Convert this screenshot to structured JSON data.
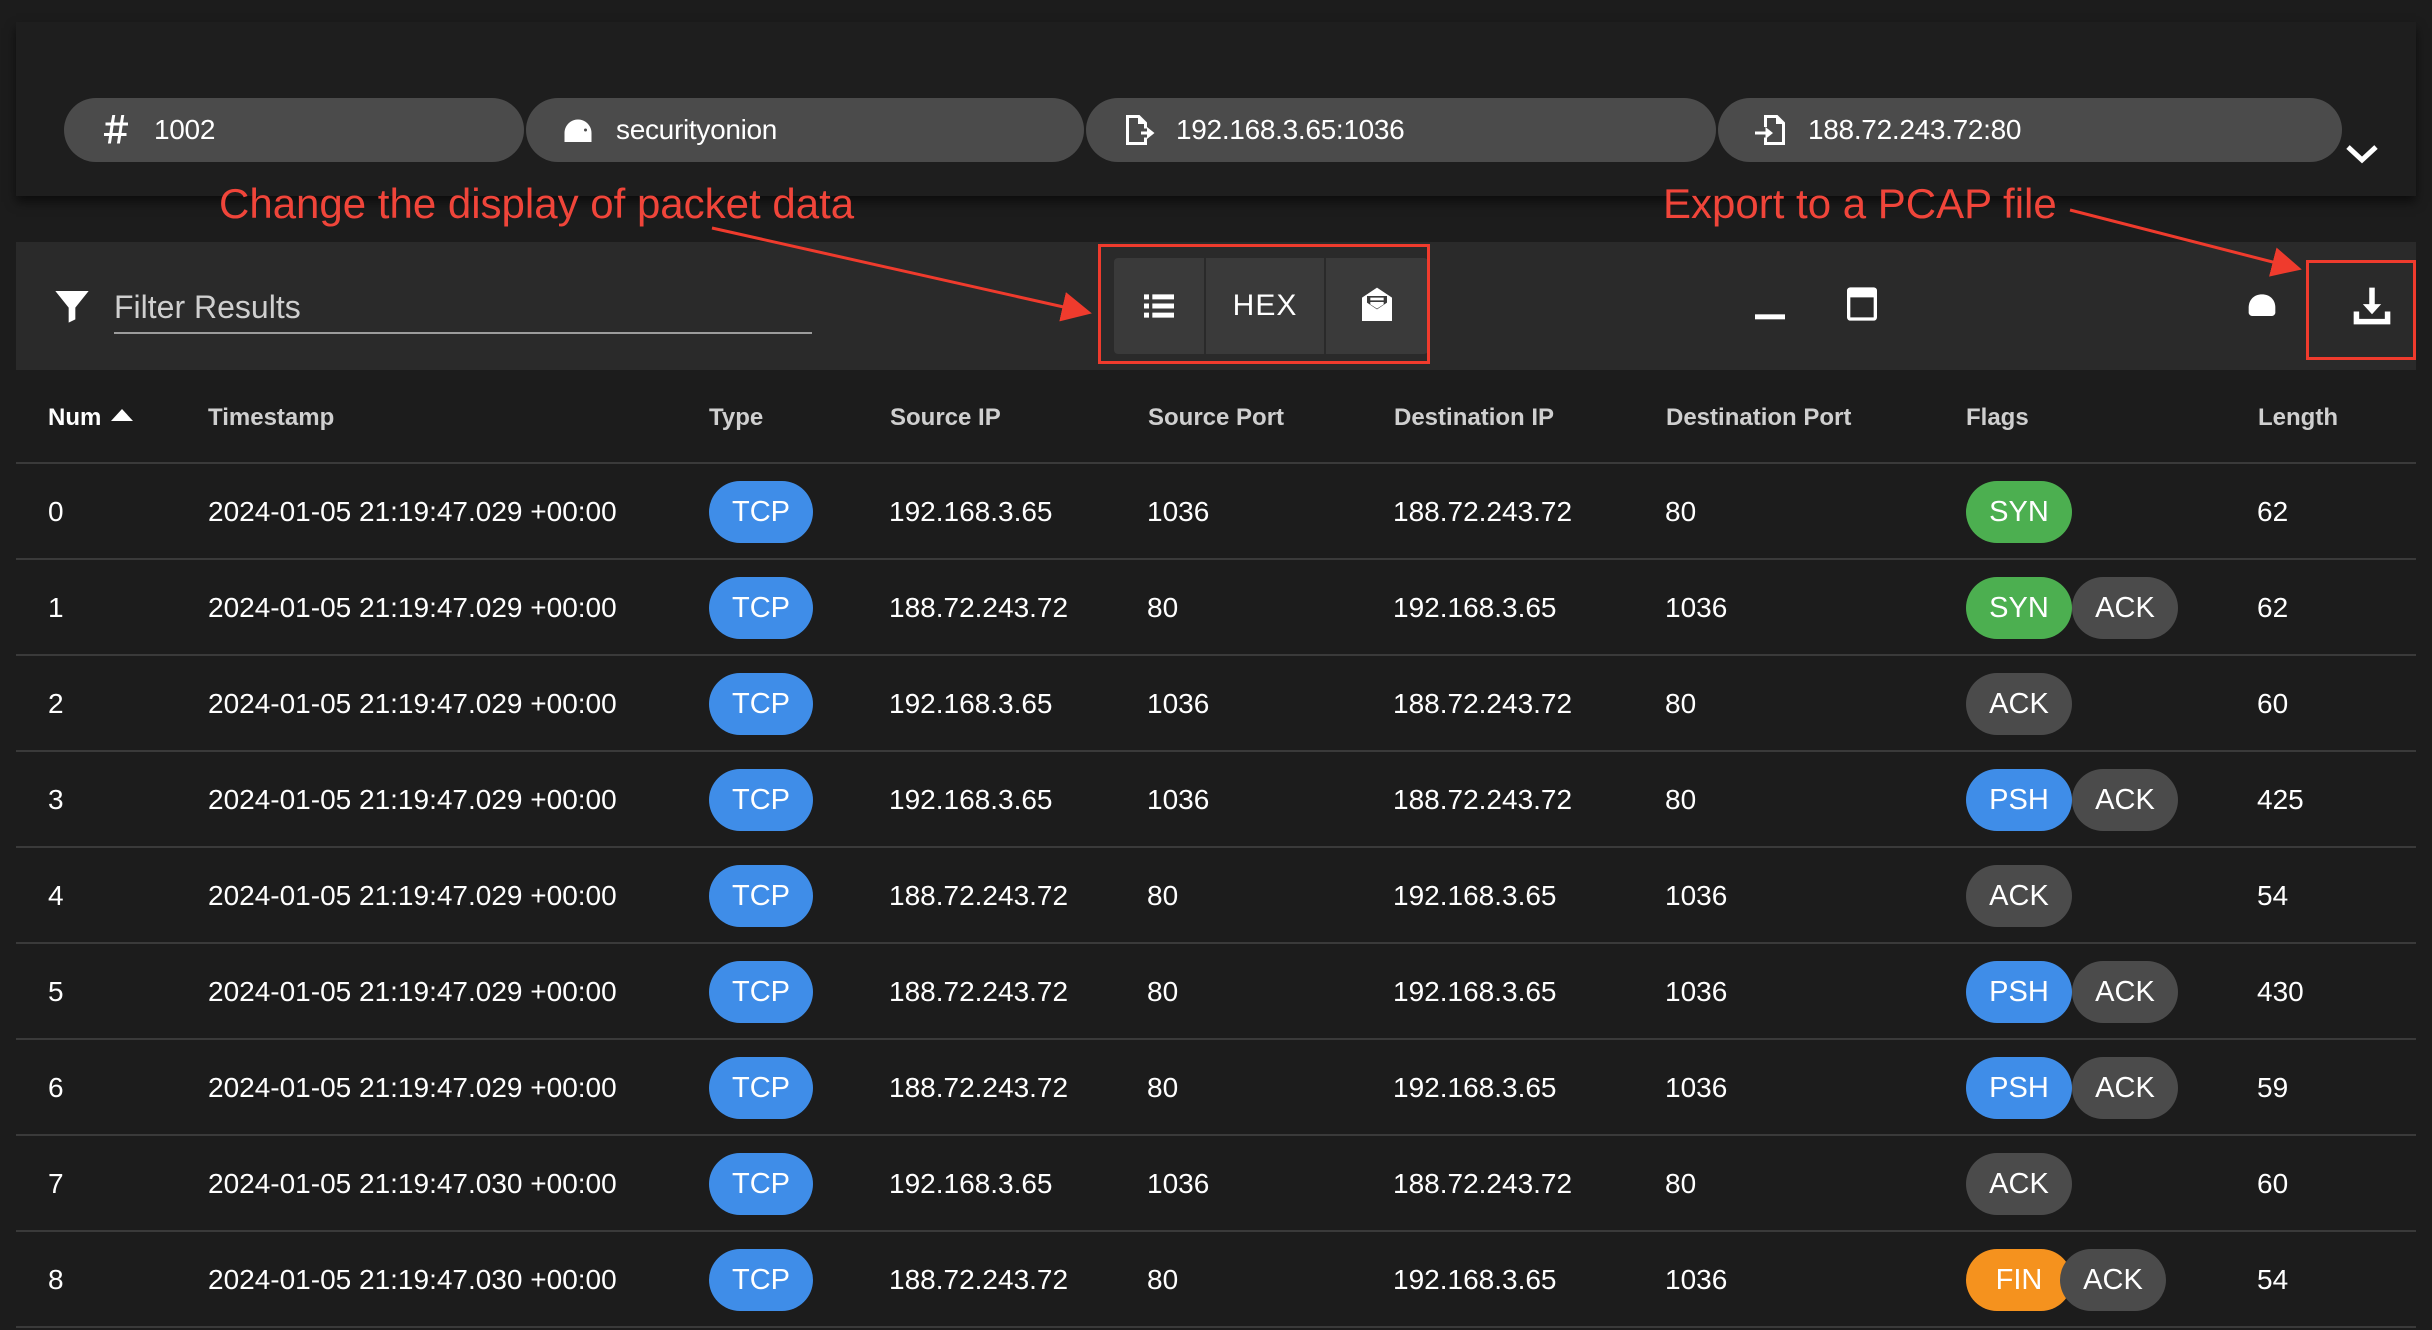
{
  "summary": {
    "chips": [
      {
        "icon": "hash-icon",
        "text": "1002"
      },
      {
        "icon": "sensor-icon",
        "text": "securityonion"
      },
      {
        "icon": "file-export-icon",
        "text": "192.168.3.65:1036"
      },
      {
        "icon": "file-import-icon",
        "text": "188.72.243.72:80"
      }
    ],
    "expand_icon": "chevron-down-icon"
  },
  "annotations": {
    "display_note": "Change the display of packet data",
    "export_note": "Export to a PCAP file",
    "color": "#f0453a"
  },
  "toolbar": {
    "filter_placeholder": "Filter Results",
    "hex_label": "HEX",
    "view_buttons": [
      "list-icon",
      "HEX",
      "envelope-open-icon"
    ],
    "right_icons": [
      "minimize-icon",
      "window-icon",
      "hat-icon",
      "download-icon"
    ]
  },
  "table": {
    "columns": [
      "Num",
      "Timestamp",
      "Type",
      "Source IP",
      "Source Port",
      "Destination IP",
      "Destination Port",
      "Flags",
      "Length"
    ],
    "sorted_column": "Num",
    "sort_direction": "ascending",
    "rows": [
      {
        "num": "0",
        "timestamp": "2024-01-05 21:19:47.029 +00:00",
        "type": "TCP",
        "src_ip": "192.168.3.65",
        "src_port": "1036",
        "dst_ip": "188.72.243.72",
        "dst_port": "80",
        "flags": [
          "SYN"
        ],
        "length": "62"
      },
      {
        "num": "1",
        "timestamp": "2024-01-05 21:19:47.029 +00:00",
        "type": "TCP",
        "src_ip": "188.72.243.72",
        "src_port": "80",
        "dst_ip": "192.168.3.65",
        "dst_port": "1036",
        "flags": [
          "SYN",
          "ACK"
        ],
        "length": "62"
      },
      {
        "num": "2",
        "timestamp": "2024-01-05 21:19:47.029 +00:00",
        "type": "TCP",
        "src_ip": "192.168.3.65",
        "src_port": "1036",
        "dst_ip": "188.72.243.72",
        "dst_port": "80",
        "flags": [
          "ACK"
        ],
        "length": "60"
      },
      {
        "num": "3",
        "timestamp": "2024-01-05 21:19:47.029 +00:00",
        "type": "TCP",
        "src_ip": "192.168.3.65",
        "src_port": "1036",
        "dst_ip": "188.72.243.72",
        "dst_port": "80",
        "flags": [
          "PSH",
          "ACK"
        ],
        "length": "425"
      },
      {
        "num": "4",
        "timestamp": "2024-01-05 21:19:47.029 +00:00",
        "type": "TCP",
        "src_ip": "188.72.243.72",
        "src_port": "80",
        "dst_ip": "192.168.3.65",
        "dst_port": "1036",
        "flags": [
          "ACK"
        ],
        "length": "54"
      },
      {
        "num": "5",
        "timestamp": "2024-01-05 21:19:47.029 +00:00",
        "type": "TCP",
        "src_ip": "188.72.243.72",
        "src_port": "80",
        "dst_ip": "192.168.3.65",
        "dst_port": "1036",
        "flags": [
          "PSH",
          "ACK"
        ],
        "length": "430"
      },
      {
        "num": "6",
        "timestamp": "2024-01-05 21:19:47.029 +00:00",
        "type": "TCP",
        "src_ip": "188.72.243.72",
        "src_port": "80",
        "dst_ip": "192.168.3.65",
        "dst_port": "1036",
        "flags": [
          "PSH",
          "ACK"
        ],
        "length": "59"
      },
      {
        "num": "7",
        "timestamp": "2024-01-05 21:19:47.030 +00:00",
        "type": "TCP",
        "src_ip": "192.168.3.65",
        "src_port": "1036",
        "dst_ip": "188.72.243.72",
        "dst_port": "80",
        "flags": [
          "ACK"
        ],
        "length": "60"
      },
      {
        "num": "8",
        "timestamp": "2024-01-05 21:19:47.030 +00:00",
        "type": "TCP",
        "src_ip": "188.72.243.72",
        "src_port": "80",
        "dst_ip": "192.168.3.65",
        "dst_port": "1036",
        "flags": [
          "FIN",
          "ACK"
        ],
        "length": "54"
      }
    ]
  },
  "colors": {
    "type_pill": "#3f8de8",
    "SYN": "#4caf50",
    "ACK": "#4b4b4b",
    "PSH": "#3f8de8",
    "FIN": "#f5921e"
  }
}
